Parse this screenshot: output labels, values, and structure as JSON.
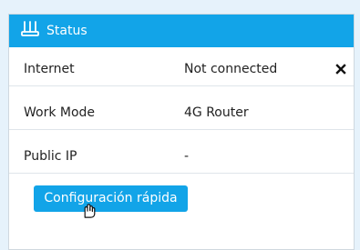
{
  "card": {
    "title": "Status",
    "router_icon": "router-icon",
    "accent_color": "#12a4e8"
  },
  "rows": [
    {
      "label": "Internet",
      "value": "Not connected",
      "action_icon": "close-icon"
    },
    {
      "label": "Work Mode",
      "value": "4G Router"
    },
    {
      "label": "Public IP",
      "value": "-"
    }
  ],
  "quick_config": {
    "label": "Configuración rápida"
  },
  "cursor": {
    "icon": "hand-cursor-icon"
  }
}
